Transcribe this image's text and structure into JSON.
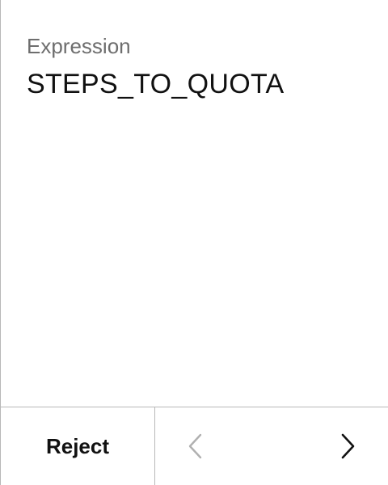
{
  "expression": {
    "label": "Expression",
    "value": "STEPS_TO_QUOTA"
  },
  "footer": {
    "reject_label": "Reject",
    "prev_icon": "chevron-left-icon",
    "next_icon": "chevron-right-icon"
  },
  "colors": {
    "label": "#6e6e6e",
    "text": "#111111",
    "divider": "#b8b8b8",
    "prev_disabled": "#b0b0b0",
    "next_enabled": "#111111"
  }
}
